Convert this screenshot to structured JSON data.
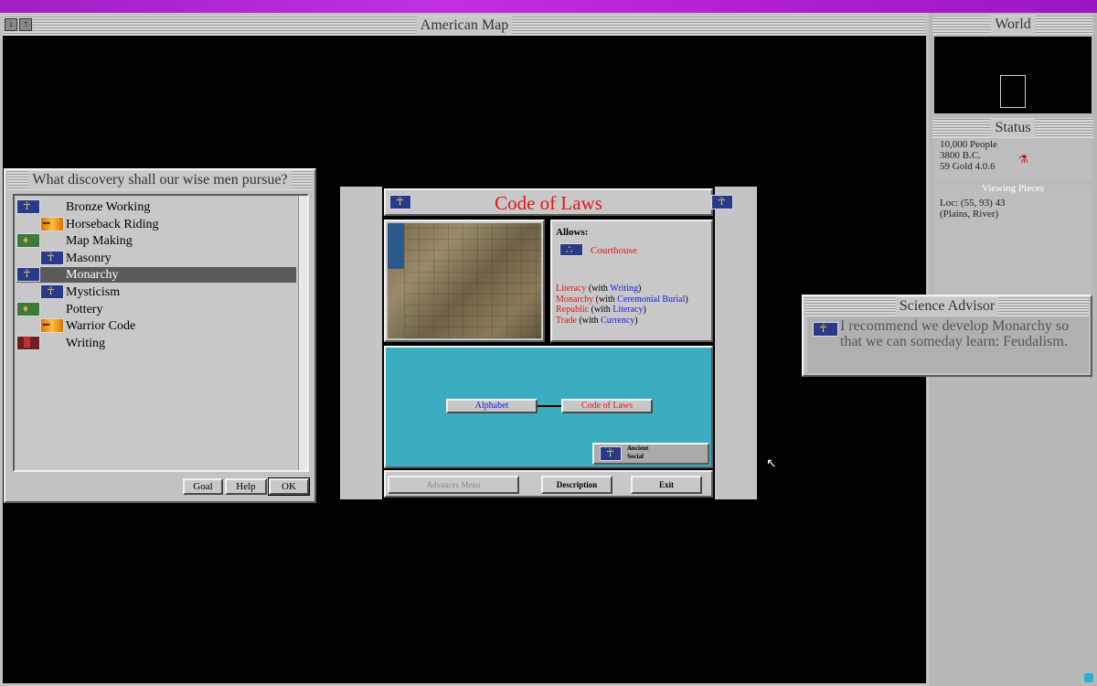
{
  "map_window": {
    "title": "American Map"
  },
  "world_window": {
    "title": "World"
  },
  "status_window": {
    "title": "Status",
    "people": "10,000 People",
    "year": "3800 B.C.",
    "gold": "59 Gold  4.0.6",
    "viewing": "Viewing Pieces",
    "loc": "Loc: (55, 93) 43",
    "terrain": "(Plains, River)"
  },
  "discovery_dialog": {
    "title": "What discovery shall our wise men pursue?",
    "items": [
      {
        "label": "Bronze Working",
        "icon": "bronze-working-icon"
      },
      {
        "label": "Horseback Riding",
        "icon": "horseback-riding-icon"
      },
      {
        "label": "Map Making",
        "icon": "map-making-icon"
      },
      {
        "label": "Masonry",
        "icon": "masonry-icon"
      },
      {
        "label": "Monarchy",
        "icon": "monarchy-icon",
        "selected": true
      },
      {
        "label": "Mysticism",
        "icon": "mysticism-icon"
      },
      {
        "label": "Pottery",
        "icon": "pottery-icon"
      },
      {
        "label": "Warrior Code",
        "icon": "warrior-code-icon"
      },
      {
        "label": "Writing",
        "icon": "writing-icon"
      }
    ],
    "buttons": {
      "goal": "Goal",
      "help": "Help",
      "ok": "OK"
    }
  },
  "civilopedia": {
    "title": "Code of Laws",
    "allows_label": "Allows:",
    "allows_item": "Courthouse",
    "leads_to": [
      {
        "name": "Literacy",
        "with_label": "(with",
        "with": "Writing",
        "close": ")"
      },
      {
        "name": "Monarchy",
        "with_label": "(with",
        "with": "Ceremonial Burial",
        "close": ")"
      },
      {
        "name": "Republic",
        "with_label": "(with",
        "with": "Literacy",
        "close": ")"
      },
      {
        "name": "Trade",
        "with_label": "(with",
        "with": "Currency",
        "close": ")"
      }
    ],
    "tree": {
      "prereq": "Alphabet",
      "current": "Code of Laws"
    },
    "era": {
      "line1": "Ancient",
      "line2": "Social"
    },
    "buttons": {
      "advances": "Advances Menu",
      "description": "Description",
      "exit": "Exit"
    }
  },
  "science_advisor": {
    "title": "Science Advisor",
    "message": "I recommend we develop Monarchy so that we can someday learn: Feudalism."
  },
  "colors": {
    "window_gray": "#c2c2c2",
    "highlight": "#5a5a5a",
    "tech_red": "#e01818",
    "tech_blue": "#1a1ae0",
    "tree_bg": "#3aaec0"
  }
}
